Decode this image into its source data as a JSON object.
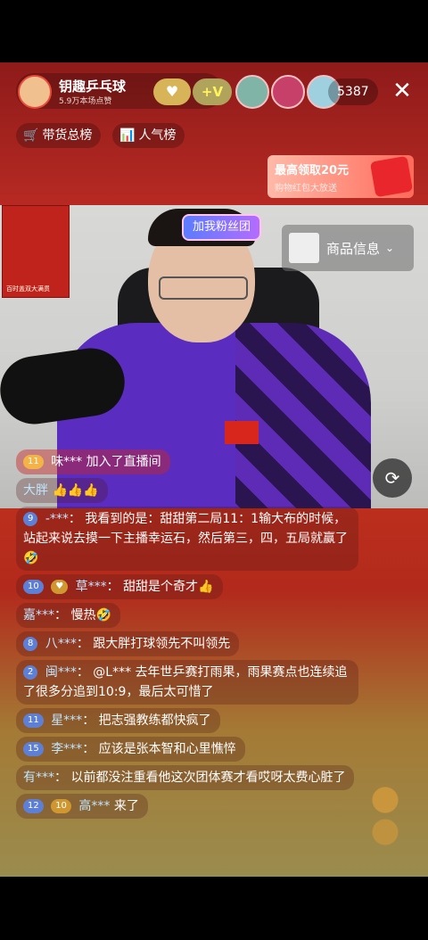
{
  "host": {
    "name": "钥趣乒乓球",
    "likes": "5.9万本场点赞",
    "fan_icon": "♥",
    "plus_label": "+V"
  },
  "viewers": {
    "count": "5387"
  },
  "ranks": [
    {
      "icon": "🛒",
      "label": "带货总榜"
    },
    {
      "icon": "📊",
      "label": "人气榜"
    }
  ],
  "promo": {
    "title": "最高领取20元",
    "subtitle": "购物红包大放送"
  },
  "video": {
    "fan_badge": "加我粉丝团",
    "product_label": "商品信息",
    "poster_text": "百时盖双大满贯"
  },
  "chat": [
    {
      "type": "join",
      "level": "11",
      "user": "味***",
      "text": "加入了直播间"
    },
    {
      "type": "msg",
      "user": "大胖",
      "text": "👍👍👍"
    },
    {
      "type": "msg",
      "level": "9",
      "user": "-***",
      "text": "我看到的是：甜甜第二局11：1输大布的时候，站起来说去摸一下主播幸运石，然后第三，四，五局就赢了🤣"
    },
    {
      "type": "msg",
      "level": "10",
      "fan_level": "♥",
      "user": "草***",
      "text": "甜甜是个奇才👍"
    },
    {
      "type": "msg",
      "user": "嘉***",
      "text": "慢热🤣"
    },
    {
      "type": "msg",
      "level": "8",
      "user": "八***",
      "text": "跟大胖打球领先不叫领先"
    },
    {
      "type": "msg",
      "level": "2",
      "user": "闽***",
      "text": "@L*** 去年世乒赛打雨果，雨果赛点也连续追了很多分追到10:9，最后太可惜了"
    },
    {
      "type": "msg",
      "level": "11",
      "user": "星***",
      "text": "把志强教练都快疯了"
    },
    {
      "type": "msg",
      "level": "15",
      "user": "李***",
      "text": "应该是张本智和心里憔悴"
    },
    {
      "type": "msg",
      "user": "有***",
      "text": "以前都没注重看他这次团体赛才看哎呀太费心脏了"
    },
    {
      "type": "msg",
      "level": "12",
      "fan_level": "10",
      "user": "高***",
      "text": "来了"
    }
  ]
}
